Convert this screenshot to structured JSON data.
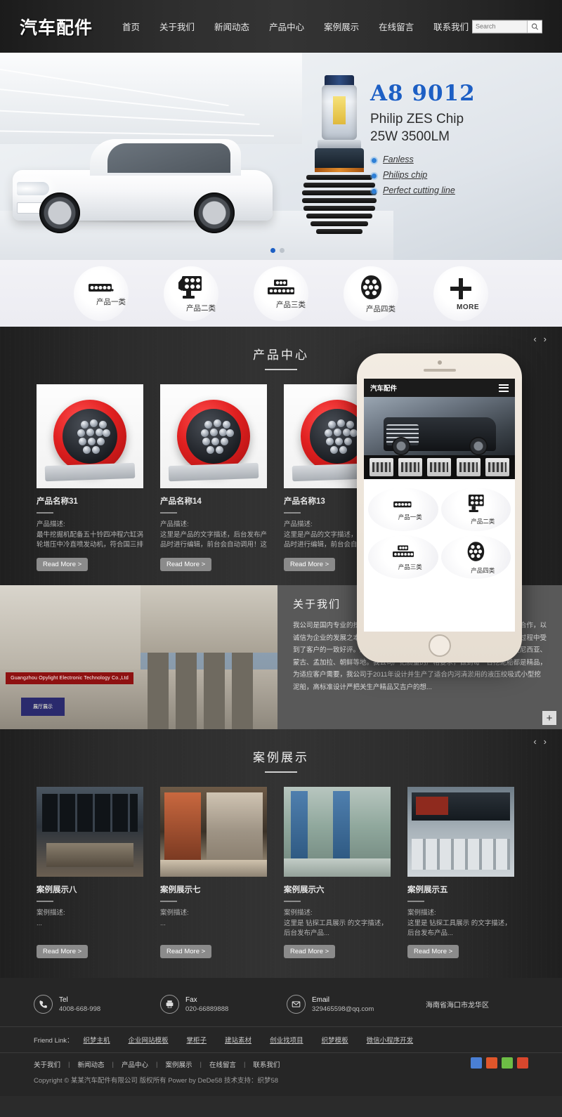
{
  "header": {
    "logo": "汽车配件",
    "nav": [
      {
        "label": "首页"
      },
      {
        "label": "关于我们"
      },
      {
        "label": "新闻动态"
      },
      {
        "label": "产品中心"
      },
      {
        "label": "案例展示"
      },
      {
        "label": "在线留言"
      },
      {
        "label": "联系我们"
      }
    ],
    "search": {
      "placeholder": "Search",
      "icon": "search-icon",
      "value": ""
    }
  },
  "banner": {
    "title": "A8 9012",
    "subtitle_line1": "Philip ZES Chip",
    "subtitle_line2": "25W 3500LM",
    "features": [
      "Fanless",
      "Philips chip",
      "Perfect cutting line"
    ],
    "title_color": "#1d5fc4",
    "dots": [
      "active",
      "inactive"
    ]
  },
  "categories": [
    {
      "label": "产品一类",
      "icon": "led-bar-icon"
    },
    {
      "label": "产品二类",
      "icon": "led-panel-icon"
    },
    {
      "label": "产品三类",
      "icon": "led-stack-icon"
    },
    {
      "label": "产品四类",
      "icon": "led-round-icon"
    },
    {
      "label": "MORE",
      "icon": "plus-icon"
    }
  ],
  "products_section": {
    "title": "产品中心",
    "prev_arrow": "‹",
    "next_arrow": "›",
    "items": [
      {
        "name": "产品名称31",
        "desc_label": "产品描述:",
        "desc": "最牛挖掘机配备五十铃四冲程六缸涡轮增压中冷直喷发动机，符合国三排放标准...",
        "button": "Read More >"
      },
      {
        "name": "产品名称14",
        "desc_label": "产品描述:",
        "desc": "这里是产品的文字描述，后台发布产品时进行编辑，前台会自动调用！这里是...",
        "button": "Read More >"
      },
      {
        "name": "产品名称13",
        "desc_label": "产品描述:",
        "desc": "这里是产品的文字描述，后台发布产品时进行编辑，前台会自动调用！这里是...",
        "button": "Read More >"
      }
    ]
  },
  "about": {
    "title": "关于我们",
    "body": "我公司是国内专业的挖泥船制造企业之一，与国内著名的科研院所、高等院校合作，以诚信为企业的发展之本，多年来稳定了稳固的挖泥船市场，在多年的生产销售过程中受到了客户的一致好评。产品远销国际市场，成功出口到尼日利亚、越南、印度尼西亚、蒙古、孟加拉、朝鲜等地。我公司严把质量的严格要求，做到每一台挖泥船都是精品，为适应客户需要，我公司于2011年设计并生产了适合内河清淤用的液压绞吸式小型挖泥船，高标准设计严把关生产精品又吉户的想...",
    "plus_button": "+",
    "signboard": "Guangzhou Opylight Electronic Technology Co.,Ltd",
    "signboard2": "展厅展示"
  },
  "phone_mockup": {
    "logo": "汽车配件",
    "menu_icon": "hamburger-icon",
    "categories": [
      {
        "label": "产品一类"
      },
      {
        "label": "产品二类"
      },
      {
        "label": "产品三类"
      },
      {
        "label": "产品四类"
      }
    ]
  },
  "cases_section": {
    "title": "案例展示",
    "prev_arrow": "‹",
    "next_arrow": "›",
    "items": [
      {
        "name": "案例展示八",
        "desc_label": "案例描述:",
        "desc": "...",
        "button": "Read More >"
      },
      {
        "name": "案例展示七",
        "desc_label": "案例描述:",
        "desc": "...",
        "button": "Read More >"
      },
      {
        "name": "案例展示六",
        "desc_label": "案例描述:",
        "desc": "这里是 钻探工具展示 的文字描述，后台发布产品...",
        "button": "Read More >"
      },
      {
        "name": "案例展示五",
        "desc_label": "案例描述:",
        "desc": "这里是 钻探工具展示 的文字描述，后台发布产品...",
        "button": "Read More >"
      }
    ]
  },
  "footer": {
    "contacts": [
      {
        "icon": "phone-icon",
        "label": "Tel",
        "value": "4008-668-998"
      },
      {
        "icon": "fax-icon",
        "label": "Fax",
        "value": "020-66889888"
      },
      {
        "icon": "mail-icon",
        "label": "Email",
        "value": "329465598@qq.com"
      }
    ],
    "address": "海南省海口市龙华区",
    "friend_label": "Friend Link：",
    "friend_links": [
      "织梦主机",
      "企业网站模板",
      "掌柜子",
      "建站素材",
      "创业找项目",
      "织梦模板",
      "微信小程序开发"
    ],
    "bottom_links": [
      "关于我们",
      "新闻动态",
      "产品中心",
      "案例展示",
      "在线留言",
      "联系我们"
    ],
    "separator": "|",
    "socials": [
      {
        "name": "twitter-icon",
        "color": "#4a7fd4"
      },
      {
        "name": "facebook-icon",
        "color": "#e0562b"
      },
      {
        "name": "wechat-icon",
        "color": "#6dbd45"
      },
      {
        "name": "youtube-icon",
        "color": "#d9472d"
      }
    ],
    "copyright": "Copyright © 某某汽车配件有限公司 版权所有 Power by DeDe58 技术支持：织梦58"
  }
}
